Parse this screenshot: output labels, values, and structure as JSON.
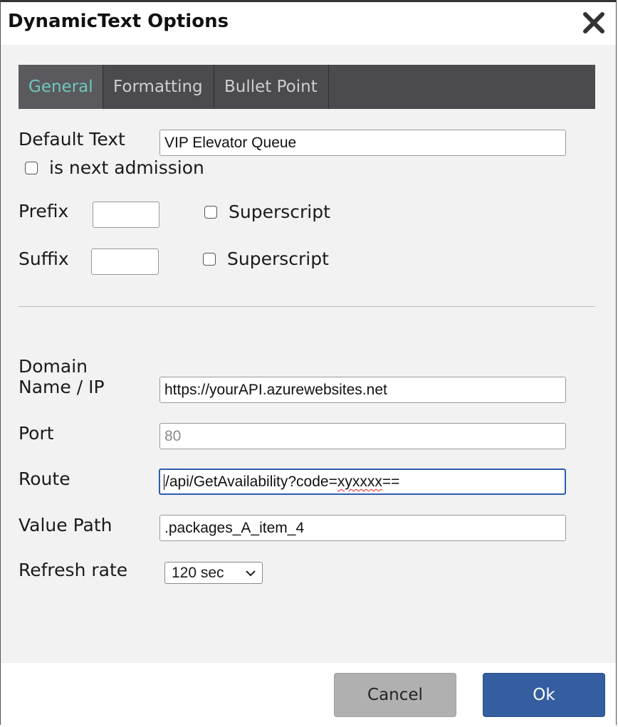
{
  "dialog": {
    "title": "DynamicText Options",
    "close_icon": "close-icon"
  },
  "tabs": [
    {
      "label": "General",
      "active": true
    },
    {
      "label": "Formatting",
      "active": false
    },
    {
      "label": "Bullet Point",
      "active": false
    }
  ],
  "general": {
    "default_text_label": "Default Text",
    "default_text_value": "VIP Elevator Queue",
    "is_next_admission_label": "is next admission",
    "is_next_admission_checked": false,
    "prefix_label": "Prefix",
    "prefix_value": "",
    "prefix_superscript_label": "Superscript",
    "prefix_superscript_checked": false,
    "suffix_label": "Suffix",
    "suffix_value": "",
    "suffix_superscript_label": "Superscript",
    "suffix_superscript_checked": false
  },
  "api": {
    "domain_label_line1": "Domain",
    "domain_label_line2": "Name / IP",
    "domain_value": "https://yourAPI.azurewebsites.net",
    "port_label": "Port",
    "port_placeholder": "80",
    "route_label": "Route",
    "route_value_main": "/api/GetAvailability?code=",
    "route_value_flagged": "xyxxxx",
    "route_value_end": "==",
    "value_path_label": "Value Path",
    "value_path_value": ".packages_A_item_4",
    "refresh_label": "Refresh rate",
    "refresh_selected": "120 sec"
  },
  "footer": {
    "cancel_label": "Cancel",
    "ok_label": "Ok"
  },
  "colors": {
    "active_tab": "#6fc7b9",
    "tab_bar": "#4b4b4f",
    "ok_button": "#345e9f",
    "cancel_button": "#b0b0b0",
    "focus_border": "#2a5db0"
  }
}
